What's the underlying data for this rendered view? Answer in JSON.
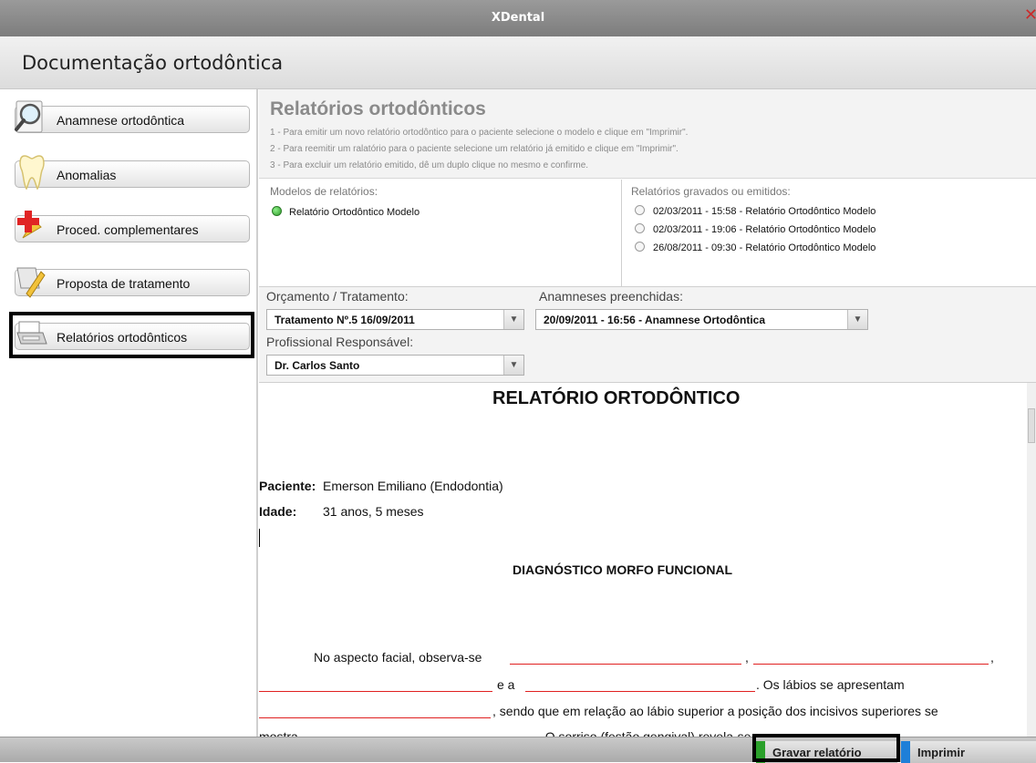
{
  "window": {
    "title": "XDental",
    "close_glyph": "✕"
  },
  "header": {
    "title": "Documentação ortodôntica"
  },
  "sidebar": {
    "items": [
      {
        "label": "Anamnese ortodôntica",
        "icon": "magnifier-icon"
      },
      {
        "label": "Anomalias",
        "icon": "tooth-icon"
      },
      {
        "label": "Proced. complementares",
        "icon": "plus-cross-icon"
      },
      {
        "label": "Proposta de tratamento",
        "icon": "pencil-icon"
      },
      {
        "label": "Relatórios ortodônticos",
        "icon": "printer-icon",
        "selected": true
      }
    ]
  },
  "reports": {
    "title": "Relatórios ortodônticos",
    "instructions": [
      "1 - Para emitir um novo relatório ortodôntico para o paciente selecione o modelo e clique em \"Imprimir\".",
      "2 - Para reemitir um ralatório para o paciente selecione um relatório já emitido e clique em \"Imprimir\".",
      "3 - Para excluir um relatório emitido, dê um duplo clique no mesmo e confirme."
    ],
    "models_header": "Modelos de relatórios:",
    "models": [
      "Relatório Ortodôntico Modelo"
    ],
    "saved_header": "Relatórios gravados ou emitidos:",
    "saved": [
      "02/03/2011 - 15:58 - Relatório Ortodôntico Modelo",
      "02/03/2011 - 19:06 - Relatório Ortodôntico Modelo",
      "26/08/2011 - 09:30 - Relatório Ortodôntico Modelo"
    ]
  },
  "filters": {
    "budget_label": "Orçamento / Tratamento:",
    "budget_value": "Tratamento Nº.5 16/09/2011",
    "anamnesis_label": "Anamneses preenchidas:",
    "anamnesis_value": "20/09/2011 - 16:56 - Anamnese Ortodôntica",
    "professional_label": "Profissional Responsável:",
    "professional_value": "Dr. Carlos Santo",
    "dropdown_glyph": "▼"
  },
  "document": {
    "title": "RELATÓRIO ORTODÔNTICO",
    "patient_label": "Paciente:",
    "patient_value": "Emerson Emiliano (Endodontia)",
    "age_label": "Idade:",
    "age_value": "31 anos, 5 meses",
    "section_title": "DIAGNÓSTICO MORFO FUNCIONAL",
    "p1_a": "No aspecto facial, observa-se",
    "p1_comma1": ",",
    "p1_comma2": ",",
    "p2_a": "e a",
    "p2_b": ". Os lábios se apresentam",
    "p3_a": ", sendo que em relação ao lábio superior a posição dos incisivos superiores se",
    "p4_a": "mostra",
    "p4_b": ". O sorriso (festão gengival) revela-se"
  },
  "footer": {
    "save_label": "Gravar relatório",
    "print_label": "Imprimir",
    "save_color": "#2aa02a",
    "print_color": "#1e7fd8"
  }
}
